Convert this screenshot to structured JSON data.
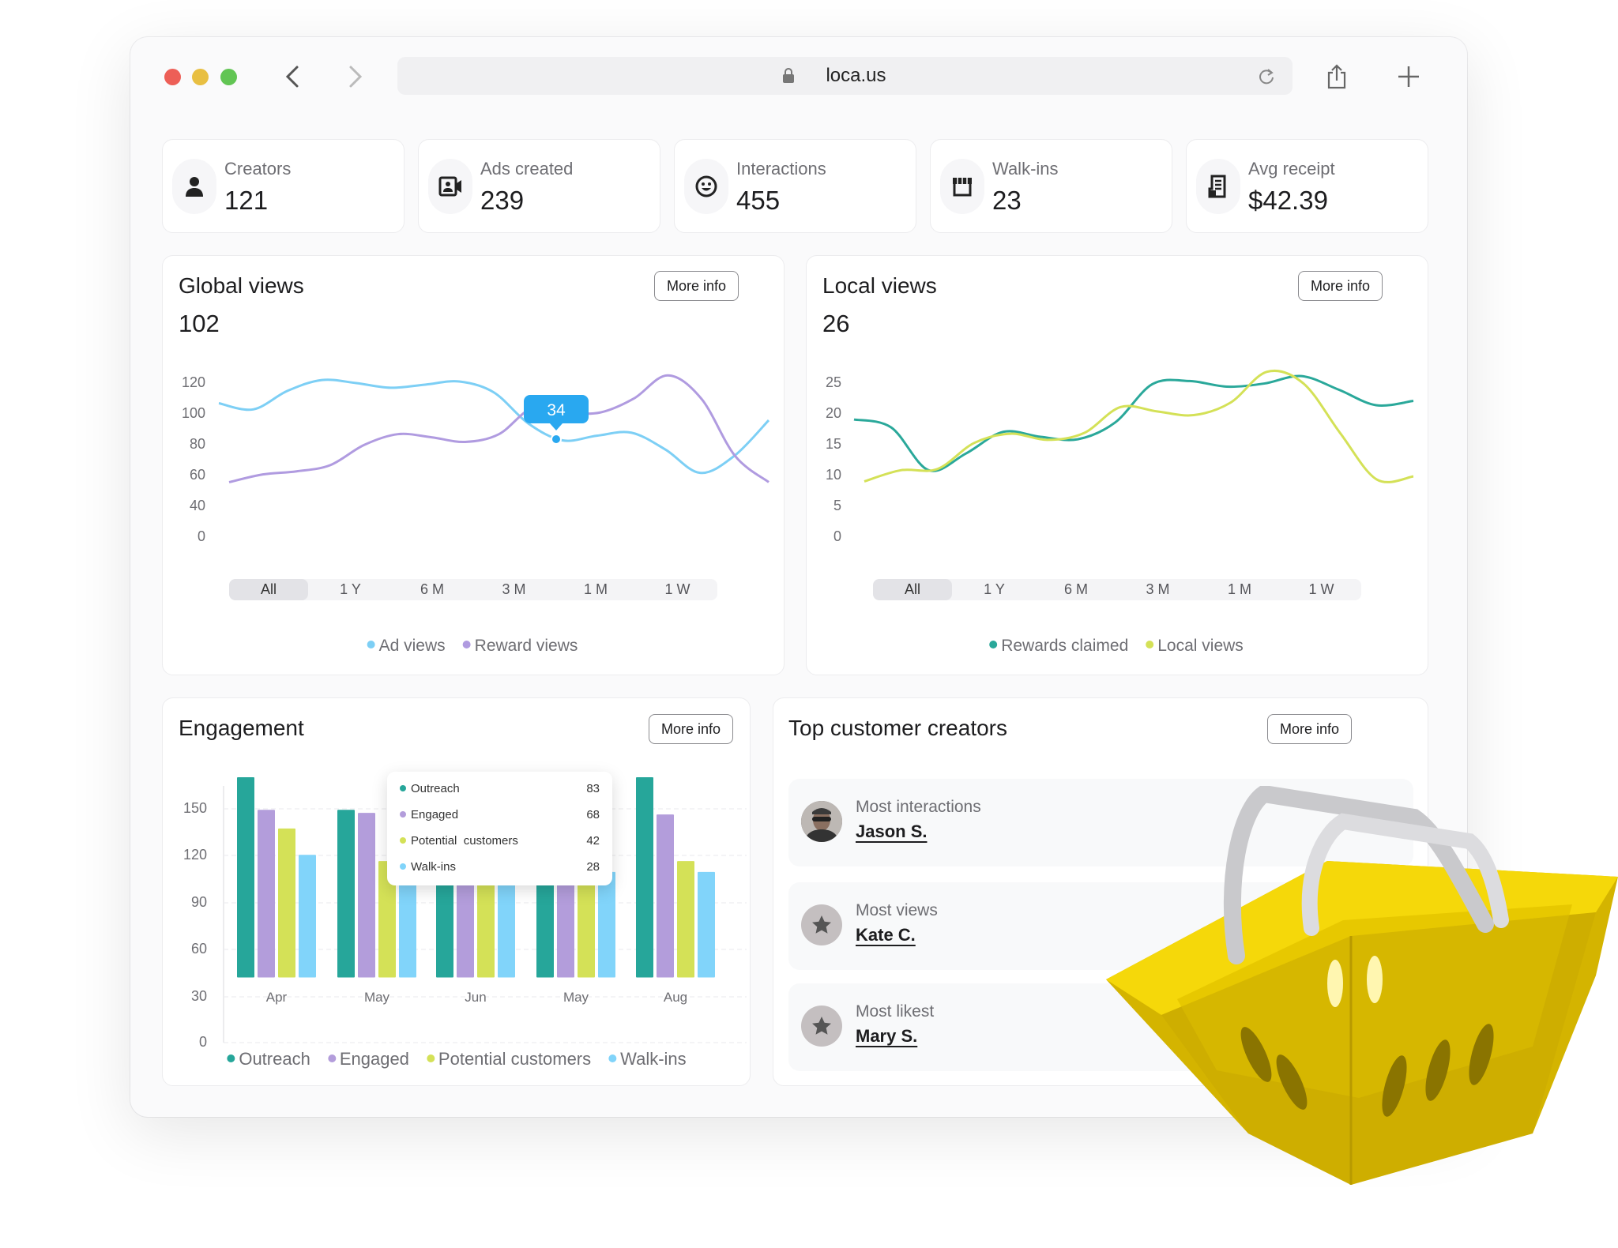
{
  "browser": {
    "url": "loca.us",
    "traffic_lights": [
      "#ed5f57",
      "#e8bf42",
      "#62c554"
    ]
  },
  "stats": [
    {
      "label": "Creators",
      "value": "121",
      "icon": "person-icon"
    },
    {
      "label": "Ads created",
      "value": "239",
      "icon": "video-contact-icon"
    },
    {
      "label": "Interactions",
      "value": "455",
      "icon": "smiley-icon"
    },
    {
      "label": "Walk-ins",
      "value": "23",
      "icon": "storefront-icon"
    },
    {
      "label": "Avg receipt",
      "value": "$42.39",
      "icon": "receipt-icon"
    }
  ],
  "more_info": "More info",
  "ranges": [
    "All",
    "1 Y",
    "6 M",
    "3 M",
    "1 M",
    "1 W"
  ],
  "global": {
    "title": "Global views",
    "value": "102",
    "tooltip": "34"
  },
  "local": {
    "title": "Local views",
    "value": "26"
  },
  "engagement": {
    "title": "Engagement",
    "tooltip": [
      {
        "label": "Outreach",
        "value": "83"
      },
      {
        "label": "Engaged",
        "value": "68"
      },
      {
        "label": "Potential  customers",
        "value": "42"
      },
      {
        "label": "Walk-ins",
        "value": "28"
      }
    ]
  },
  "top": {
    "title": "Top customer creators",
    "rows": [
      {
        "label": "Most interactions",
        "name": "Jason S.",
        "avatar": "photo"
      },
      {
        "label": "Most views",
        "name": "Kate C.",
        "avatar": "star-icon"
      },
      {
        "label": "Most likest",
        "name": "Mary S.",
        "avatar": "star-icon"
      }
    ]
  },
  "chart_data": [
    {
      "type": "line",
      "yticks": [
        "120",
        "100",
        "80",
        "60",
        "40",
        "0"
      ],
      "ylim": [
        40,
        120
      ],
      "legend": "bottom",
      "series": [
        {
          "name": "Ad views",
          "color": "#7dcff5",
          "values": [
            107,
            103,
            115,
            122,
            120,
            117,
            119,
            121,
            114,
            94,
            83,
            86,
            88,
            77,
            62,
            73,
            96
          ]
        },
        {
          "name": "Reward views",
          "color": "#b09be0",
          "values": [
            56,
            61,
            63,
            67,
            80,
            87,
            85,
            82,
            87,
            104,
            101,
            101,
            110,
            125,
            110,
            73,
            56
          ]
        }
      ]
    },
    {
      "type": "line",
      "yticks": [
        "25",
        "20",
        "15",
        "10",
        "5",
        "0"
      ],
      "ylim": [
        0,
        25
      ],
      "legend": "bottom",
      "series": [
        {
          "name": "Rewards claimed",
          "color": "#2aa89a",
          "values": [
            19,
            17.7,
            10.8,
            13.5,
            17,
            16.2,
            15.8,
            18.5,
            24.7,
            25.2,
            24.3,
            24.8,
            26,
            23.8,
            21.3,
            22
          ]
        },
        {
          "name": "Local views",
          "color": "#d4e157",
          "values": [
            9,
            10.8,
            11,
            15.2,
            16.7,
            15.7,
            16.8,
            21,
            20.3,
            19.7,
            21.7,
            26.7,
            24.8,
            16.8,
            9.3,
            9.8
          ]
        }
      ]
    },
    {
      "type": "bar",
      "categories": [
        "Apr",
        "May",
        "Jun",
        "May",
        "Aug"
      ],
      "yticks": [
        "150",
        "120",
        "90",
        "60",
        "30",
        "0"
      ],
      "ylim": [
        0,
        180
      ],
      "legend": "bottom",
      "series": [
        {
          "name": "Outreach",
          "color": "#26a69a",
          "values": [
            171,
            150,
            108,
            108,
            171
          ]
        },
        {
          "name": "Engaged",
          "color": "#b39ddb",
          "values": [
            150,
            148,
            108,
            108,
            147
          ]
        },
        {
          "name": "Potential customers",
          "color": "#d4e157",
          "values": [
            138,
            117,
            108,
            108,
            117
          ]
        },
        {
          "name": "Walk-ins",
          "color": "#81d4fa",
          "values": [
            121,
            110,
            108,
            110,
            110
          ]
        }
      ]
    }
  ]
}
